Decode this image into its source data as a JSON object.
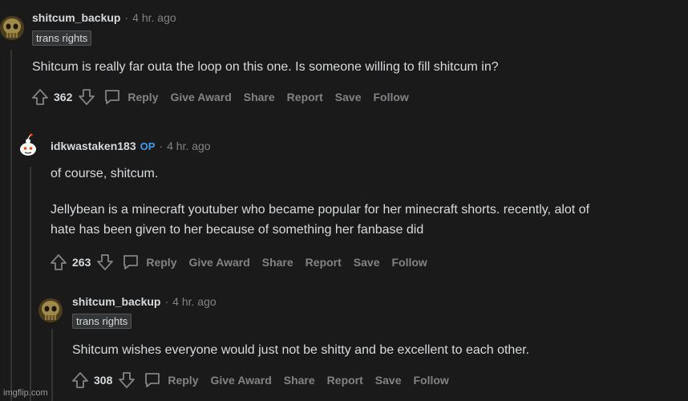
{
  "comments": [
    {
      "username": "shitcum_backup",
      "time": "4 hr. ago",
      "flair": "trans rights",
      "op_badge": "",
      "body": [
        "Shitcum is really far outa the loop on this one. Is someone willing to fill shitcum in?"
      ],
      "score": "362"
    },
    {
      "username": "idkwastaken183",
      "time": "4 hr. ago",
      "flair": "",
      "op_badge": "OP",
      "body": [
        "of course, shitcum.",
        "Jellybean is a minecraft youtuber who became popular for her minecraft shorts. recently, alot of",
        "hate has been given to her because of something her fanbase did"
      ],
      "score": "263"
    },
    {
      "username": "shitcum_backup",
      "time": "4 hr. ago",
      "flair": "trans rights",
      "op_badge": "",
      "body": [
        "Shitcum wishes everyone would just not be shitty and be excellent to each other."
      ],
      "score": "308"
    }
  ],
  "actions": {
    "reply": "Reply",
    "give_award": "Give Award",
    "share": "Share",
    "report": "Report",
    "save": "Save",
    "follow": "Follow"
  },
  "separator": "·",
  "watermark": "imgflip.com",
  "colors": {
    "background": "#1a1a1b",
    "text": "#d7dadc",
    "muted": "#818384",
    "op_badge": "#3d9bf0",
    "thread_line": "#343536"
  },
  "icons": [
    "skull-avatar-icon",
    "snoo-avatar-icon",
    "upvote-icon",
    "downvote-icon",
    "comment-bubble-icon"
  ]
}
